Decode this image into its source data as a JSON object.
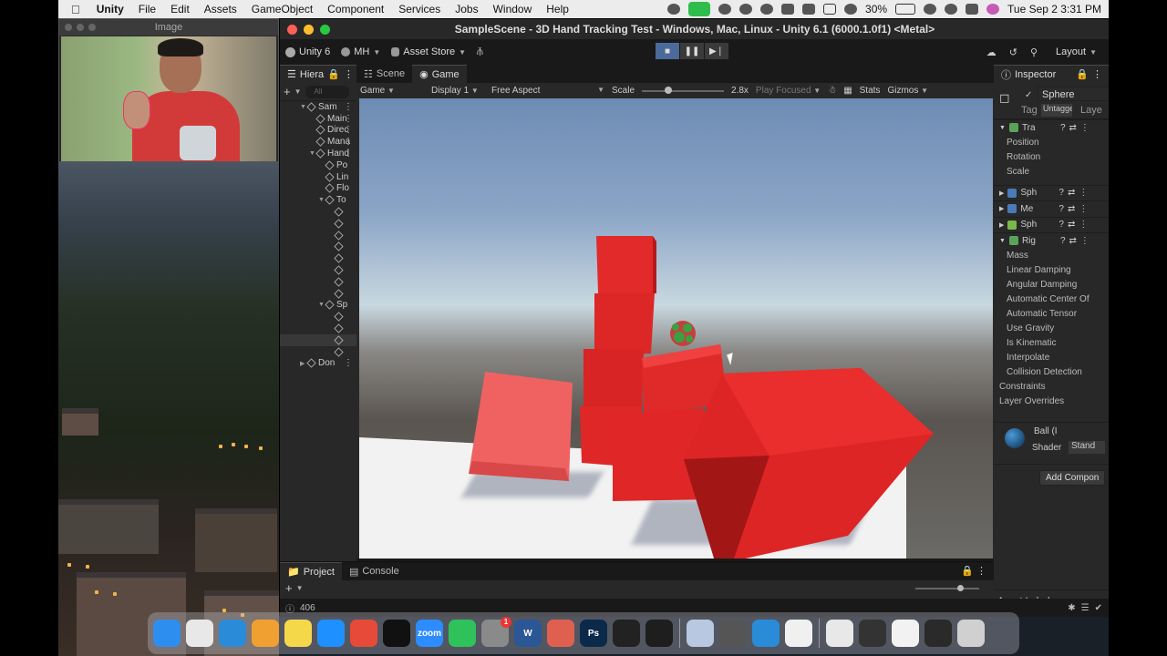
{
  "menubar": {
    "app": "Unity",
    "items": [
      "File",
      "Edit",
      "Assets",
      "GameObject",
      "Component",
      "Services",
      "Jobs",
      "Window",
      "Help"
    ],
    "battery": "30%",
    "datetime": "Tue Sep 2  3:31 PM"
  },
  "webcam": {
    "title": "Image"
  },
  "window": {
    "title": "SampleScene - 3D Hand Tracking Test - Windows, Mac, Linux - Unity 6.1 (6000.1.0f1) <Metal>"
  },
  "toolbar": {
    "unity_label": "Unity 6",
    "account": "MH",
    "asset_store": "Asset Store",
    "layout": "Layout"
  },
  "hierarchy": {
    "tab": "Hiera",
    "search": "All",
    "rows": [
      {
        "label": "Sam",
        "depth": 0,
        "expanded": true
      },
      {
        "label": "Main",
        "depth": 1
      },
      {
        "label": "Direc",
        "depth": 1
      },
      {
        "label": "Mana",
        "depth": 1
      },
      {
        "label": "Hand",
        "depth": 1,
        "expanded": true
      },
      {
        "label": "Po",
        "depth": 2
      },
      {
        "label": "Lin",
        "depth": 2
      },
      {
        "label": "Flo",
        "depth": 2
      },
      {
        "label": "To",
        "depth": 2,
        "expanded": true
      },
      {
        "label": "",
        "depth": 3
      },
      {
        "label": "",
        "depth": 3
      },
      {
        "label": "",
        "depth": 3
      },
      {
        "label": "",
        "depth": 3
      },
      {
        "label": "",
        "depth": 3
      },
      {
        "label": "",
        "depth": 3
      },
      {
        "label": "",
        "depth": 3
      },
      {
        "label": "",
        "depth": 3
      },
      {
        "label": "Sp",
        "depth": 2,
        "expanded": true
      },
      {
        "label": "",
        "depth": 3
      },
      {
        "label": "",
        "depth": 3
      },
      {
        "label": "",
        "depth": 3,
        "selected": true
      },
      {
        "label": "",
        "depth": 3
      },
      {
        "label": "Don",
        "depth": 0
      }
    ]
  },
  "tabs": {
    "scene": "Scene",
    "game": "Game"
  },
  "gamebar": {
    "mode": "Game",
    "display": "Display 1",
    "aspect": "Free Aspect",
    "scale_label": "Scale",
    "scale_value": "2.8x",
    "play_focused": "Play Focused",
    "stats": "Stats",
    "gizmos": "Gizmos"
  },
  "inspector": {
    "tab": "Inspector",
    "object_name": "Sphere",
    "tag_label": "Tag",
    "tag_value": "Untagged",
    "layer_label": "Laye",
    "components": [
      {
        "name": "Tra",
        "icon": "transform-icon",
        "color": "#5aa45a"
      },
      {
        "name": "Sph",
        "icon": "mesh-filter-icon",
        "color": "#4a7ab8"
      },
      {
        "name": "Me",
        "icon": "mesh-renderer-icon",
        "color": "#4a7ab8"
      },
      {
        "name": "Sph",
        "icon": "collider-icon",
        "color": "#7ab84a"
      },
      {
        "name": "Rig",
        "icon": "rigidbody-icon",
        "color": "#5aa45a"
      }
    ],
    "transform_fields": [
      "Position",
      "Rotation",
      "Scale"
    ],
    "rigidbody_fields": [
      "Mass",
      "Linear Damping",
      "Angular Damping",
      "Automatic Center Of",
      "Automatic Tensor",
      "Use Gravity",
      "Is Kinematic",
      "Interpolate",
      "Collision Detection",
      "Constraints",
      "Layer Overrides"
    ],
    "material_name": "Ball (I",
    "shader_label": "Shader",
    "shader_value": "Stand",
    "add_component": "Add Compon",
    "asset_labels": "Asset Labels"
  },
  "bottom": {
    "project": "Project",
    "console": "Console"
  },
  "status": {
    "count": "406"
  },
  "dock": {
    "apps": [
      {
        "name": "finder-icon",
        "color": "#2d8ef0"
      },
      {
        "name": "launchpad-icon",
        "color": "#e8e8e8"
      },
      {
        "name": "vscode-icon",
        "color": "#2a8bd8"
      },
      {
        "name": "photos-icon",
        "color": "#f0a030"
      },
      {
        "name": "notes-icon",
        "color": "#f5d84a"
      },
      {
        "name": "safari-icon",
        "color": "#1e90ff"
      },
      {
        "name": "chrome-icon",
        "color": "#e84a3a"
      },
      {
        "name": "chatgpt-icon",
        "color": "#111111"
      },
      {
        "name": "zoom-icon",
        "color": "#2d8cff",
        "label": "zoom"
      },
      {
        "name": "whatsapp-icon",
        "color": "#2fc15a"
      },
      {
        "name": "system-settings-icon",
        "color": "#8a8a8a",
        "badge": "1"
      },
      {
        "name": "word-icon",
        "color": "#2b5797",
        "label": "W"
      },
      {
        "name": "iphone-mirroring-icon",
        "color": "#e06050"
      },
      {
        "name": "photoshop-icon",
        "color": "#0b2a4a",
        "label": "Ps"
      },
      {
        "name": "unity-hub-icon",
        "color": "#222222"
      },
      {
        "name": "figma-icon",
        "color": "#1e1e1e"
      }
    ],
    "recent": [
      {
        "name": "preview-icon",
        "color": "#b8c8e0"
      },
      {
        "name": "unity-icon",
        "color": "#555555"
      },
      {
        "name": "visual-studio-icon",
        "color": "#2a8bd8"
      },
      {
        "name": "document-icon",
        "color": "#f0f0f0"
      }
    ],
    "windows": [
      {
        "name": "window-thumb-1",
        "color": "#e8e8e8"
      },
      {
        "name": "window-thumb-2",
        "color": "#333333"
      },
      {
        "name": "window-thumb-3",
        "color": "#f2f2f2"
      },
      {
        "name": "window-thumb-4",
        "color": "#2a2a2a"
      },
      {
        "name": "trash-icon",
        "color": "#d0d0d0"
      }
    ]
  }
}
